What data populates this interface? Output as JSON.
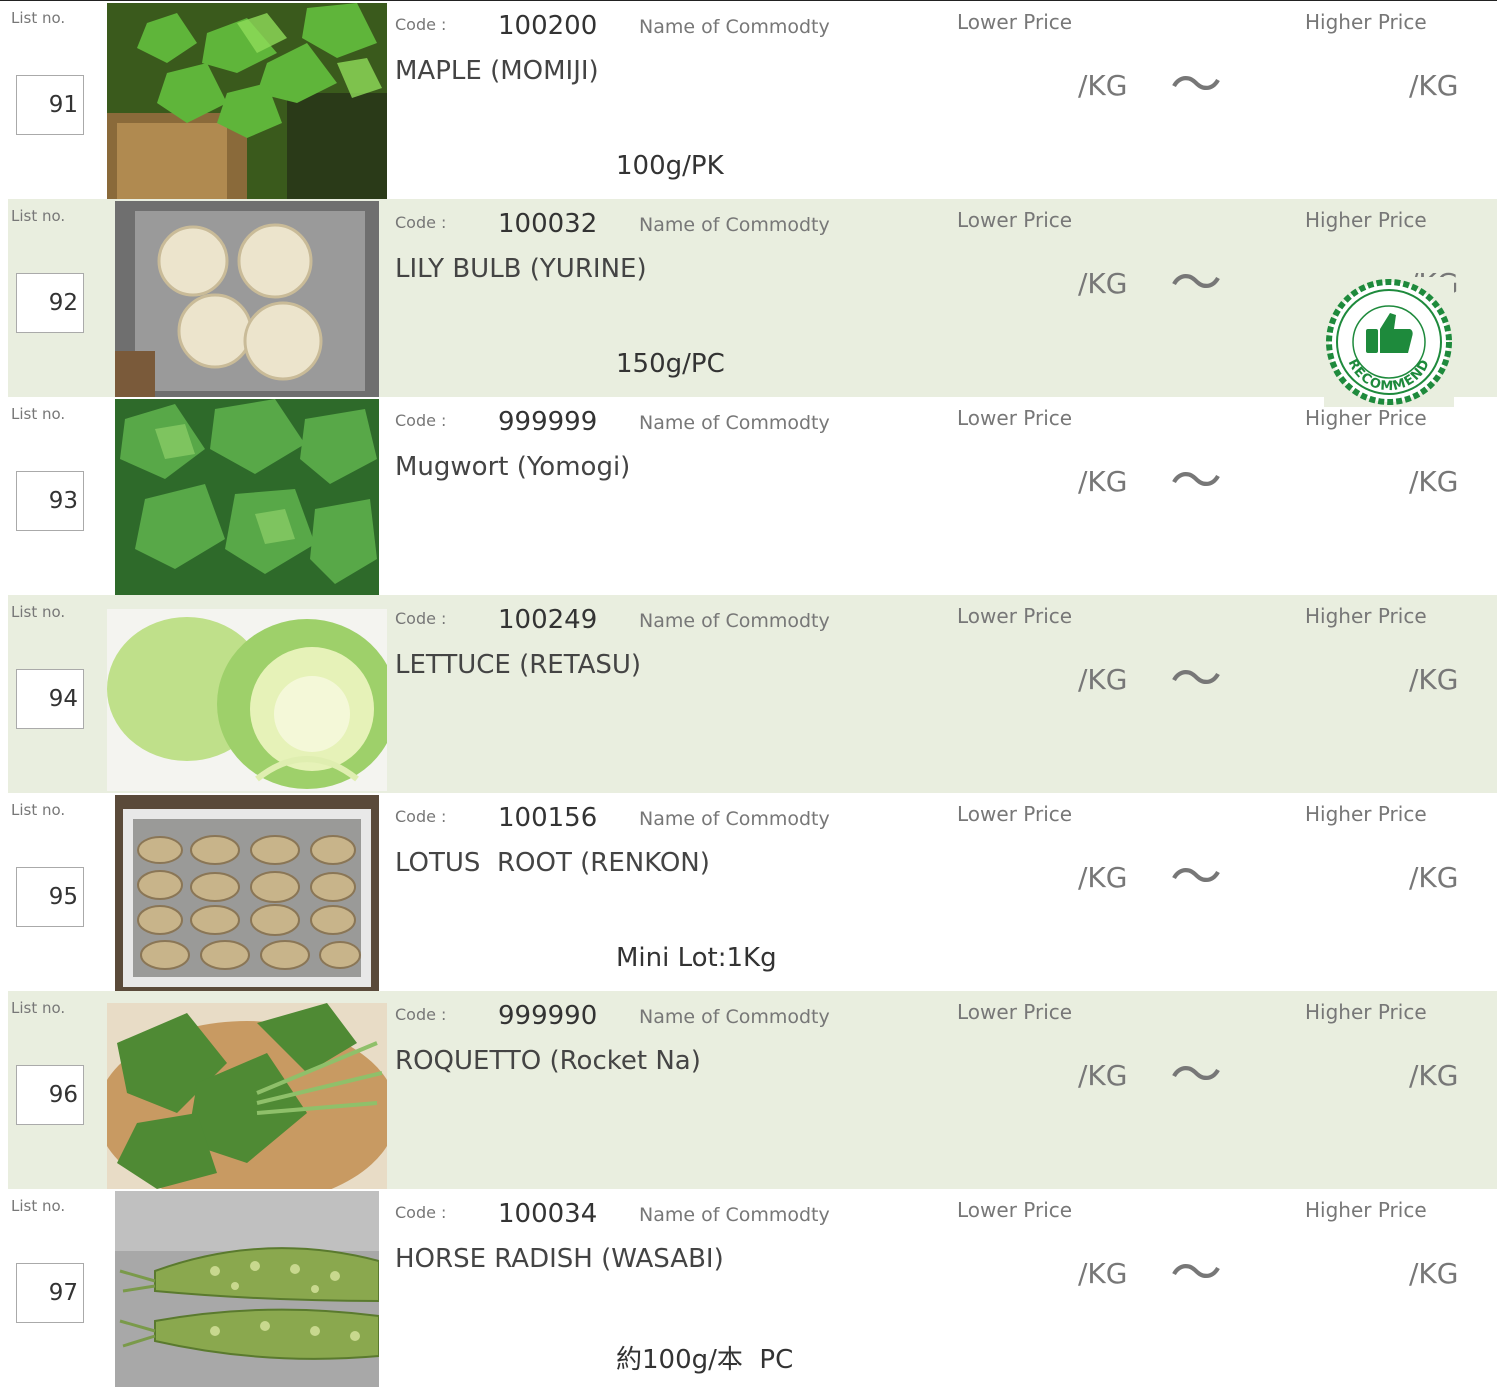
{
  "labels": {
    "list_no": "List no.",
    "code": "Code :",
    "name_of_commodity": "Name of Commodty",
    "lower_price": "Lower Price",
    "higher_price": "Higher Price",
    "per_kg": "/KG",
    "range_sep": "～"
  },
  "colors": {
    "shaded_row": "#e9eedf",
    "stamp_green": "#1e8a3c"
  },
  "items": [
    {
      "list_no": "91",
      "code": "100200",
      "name": "MAPLE (MOMIJI)",
      "unit": "100g/PK",
      "photo": "maple-leaves",
      "shaded": false
    },
    {
      "list_no": "92",
      "code": "100032",
      "name": "LILY BULB (YURINE)",
      "unit": "150g/PC",
      "photo": "lily-bulbs",
      "shaded": true,
      "stamp": "RECOMMEND"
    },
    {
      "list_no": "93",
      "code": "999999",
      "name": "Mugwort (Yomogi)",
      "unit": "",
      "photo": "mugwort-leaves",
      "shaded": false
    },
    {
      "list_no": "94",
      "code": "100249",
      "name": "LETTUCE (RETASU)",
      "unit": "",
      "photo": "lettuce",
      "shaded": true
    },
    {
      "list_no": "95",
      "code": "100156",
      "name": "LOTUS  ROOT (RENKON)",
      "unit": "Mini Lot:1Kg",
      "photo": "lotus-roots",
      "shaded": false
    },
    {
      "list_no": "96",
      "code": "999990",
      "name": "ROQUETTO (Rocket Na)",
      "unit": "",
      "photo": "rocket-greens",
      "shaded": true
    },
    {
      "list_no": "97",
      "code": "100034",
      "name": "HORSE RADISH (WASABI)",
      "unit": "約100g/本  PC",
      "photo": "wasabi-roots",
      "shaded": false
    }
  ]
}
